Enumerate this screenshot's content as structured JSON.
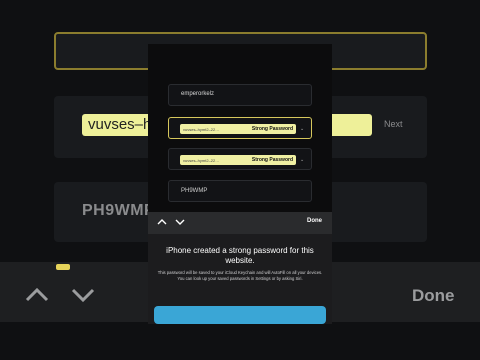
{
  "background": {
    "password_display": "vuvses–hymt2–22 …… password",
    "chevron": "Next",
    "user_code": "PH9WMP",
    "done_label": "Done"
  },
  "form": {
    "username_value": "emperorkelz",
    "password_value": "vuvses–hymt2–22…",
    "password_tag": "Strong Password",
    "confirm_value": "vuvses–hymt2–22…",
    "confirm_tag": "Strong Password",
    "code_value": "PH9WMP"
  },
  "toolbar": {
    "done_label": "Done"
  },
  "sheet": {
    "title": "iPhone created a strong password for this website.",
    "body": "This password will be saved to your iCloud Keychain and will AutoFill on all your devices. You can look up your saved passwords in Settings or by asking Siri."
  },
  "colors": {
    "autofill_highlight": "#f0f0a3",
    "focus_border": "#d6c75c",
    "primary_button": "#3aa6d6",
    "sheet_background": "#1c1c1e"
  }
}
